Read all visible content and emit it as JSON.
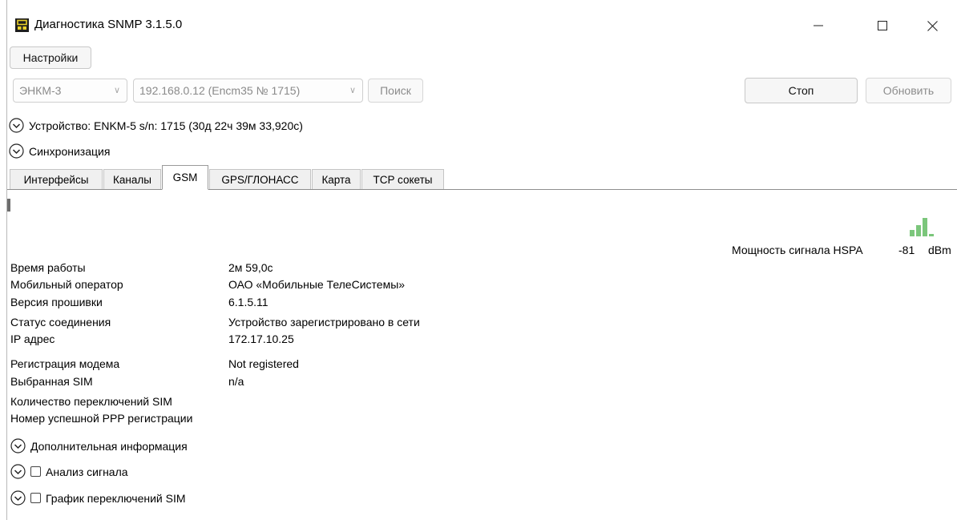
{
  "window": {
    "title": "Диагностика SNMP 3.1.5.0",
    "minimize": "—",
    "maximize": "☐",
    "close": "✕",
    "accent": "#5fb85f"
  },
  "toolbar": {
    "settings_label": "Настройки",
    "device_type": "ЭНКМ-3",
    "device_address": "192.168.0.12 (Encm35 № 1715)",
    "search_label": "Поиск",
    "stop_label": "Стоп",
    "refresh_label": "Обновить"
  },
  "sections": {
    "device": "Устройство: ENKM-5 s/n: 1715 (30д 22ч 39м 33,920с)",
    "sync": "Синхронизация"
  },
  "tabs": [
    {
      "label": "Интерфейсы"
    },
    {
      "label": "Каналы"
    },
    {
      "label": "GSM"
    },
    {
      "label": "GPS/ГЛОНАСС"
    },
    {
      "label": "Карта"
    },
    {
      "label": "TCP сокеты"
    }
  ],
  "active_tab": "GSM",
  "signal": {
    "label": "Мощность сигнала HSPA",
    "value": "-81",
    "unit": "dBm",
    "bars_lit": 3,
    "bars_total": 4,
    "bar_color_on": "#7bc67b",
    "bar_color_off": "#d9d9d9"
  },
  "gsm_info": [
    {
      "label": "Время работы",
      "value": "2м 59,0с"
    },
    {
      "label": "Мобильный оператор",
      "value": "ОАО «Мобильные ТелеСистемы»"
    },
    {
      "label": "Версия прошивки",
      "value": "6.1.5.11"
    },
    {
      "label": "Статус соединения",
      "value": "Устройство зарегистрировано в сети"
    },
    {
      "label": "IP адрес",
      "value": "172.17.10.25"
    },
    {
      "label": "Регистрация модема",
      "value": "Not registered"
    },
    {
      "label": "Выбранная SIM",
      "value": "n/a"
    },
    {
      "label": "Количество переключений SIM",
      "value": ""
    },
    {
      "label": "Номер успешной PPP регистрации",
      "value": ""
    }
  ],
  "expanders": {
    "additional_info": "Дополнительная информация",
    "signal_analysis": "Анализ сигнала",
    "sim_switch_chart": "График переключений SIM"
  }
}
